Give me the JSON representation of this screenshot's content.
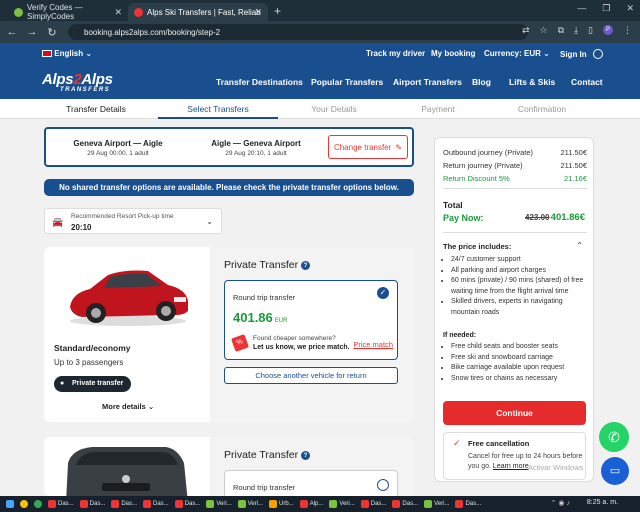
{
  "browser": {
    "tabs": [
      {
        "title": "Verify Codes — SimplyCodes",
        "active": false
      },
      {
        "title": "Alps Ski Transfers | Fast, Reliab",
        "active": true
      }
    ],
    "url": "booking.alps2alps.com/booking/step-2"
  },
  "site": {
    "language": "English",
    "top_links": {
      "track": "Track my driver",
      "booking": "My booking",
      "currency": "Currency: EUR",
      "signin": "Sign In"
    },
    "logo": {
      "text_left": "Alps",
      "text_right": "Alps",
      "mark": "2",
      "subtitle": "TRANSFERS"
    },
    "nav": [
      "Transfer Destinations",
      "Popular Transfers",
      "Airport Transfers",
      "Blog",
      "Lifts & Skis",
      "Contact"
    ]
  },
  "steps": [
    "Transfer Details",
    "Select Transfers",
    "Your Details",
    "Payment",
    "Confirmation"
  ],
  "route": {
    "outbound": {
      "title": "Geneva Airport — Aigle",
      "detail": "29 Aug 00:00, 1 adult"
    },
    "return": {
      "title": "Aigle — Geneva Airport",
      "detail": "29 Aug 20:10, 1 adult"
    },
    "change_label": "Change transfer"
  },
  "notice": "No shared transfer options are available. Please check the private transfer options below.",
  "pickup": {
    "label": "Recommended Resort Pick-up time",
    "value": "20:10"
  },
  "vehicles": [
    {
      "title": "Private Transfer",
      "class": "Standard/economy",
      "passengers": "Up to 3 passengers",
      "badge": "Private transfer",
      "more": "More details",
      "option_label": "Round trip transfer",
      "price": "401.86",
      "currency": "EUR",
      "pm_line1": "Found cheaper somewhere?",
      "pm_line2": "Let us know, we price match.",
      "pm_link": "Price match",
      "another": "Choose another vehicle for return",
      "color": "#c0141e"
    },
    {
      "title": "Private Transfer",
      "option_label": "Round trip transfer",
      "color": "#3a3f44"
    }
  ],
  "summary": {
    "outbound_label": "Outbound journey (Private)",
    "outbound_value": "211.50€",
    "return_label": "Return journey (Private)",
    "return_value": "211.50€",
    "discount_label": "Return Discount 5%",
    "discount_value": "21.16€",
    "total_label": "Total",
    "paynow_label": "Pay Now:",
    "old_price": "423.00",
    "new_price": "401.86€",
    "includes_title": "The price includes:",
    "includes": [
      "24/7 customer support",
      "All parking and airport charges",
      "60 mins (private) / 90 mins (shared) of free waiting time from the flight arrival time",
      "Skilled drivers, experts in navigating mountain roads"
    ],
    "ifneeded_title": "If needed:",
    "ifneeded": [
      "Free child seats and booster seats",
      "Free ski and snowboard carriage",
      "Bike carriage available upon request",
      "Snow tires or chains as necessary"
    ],
    "continue": "Continue",
    "freecanc_title": "Free cancellation",
    "freecanc_text": "Cancel for free up to 24 hours before you go.",
    "learn_more": "Learn more"
  },
  "watermark": "Activar Windows",
  "taskbar": {
    "items": [
      "Das...",
      "Das...",
      "Das...",
      "Das...",
      "Das...",
      "Veri...",
      "Veri...",
      "Urb...",
      "Alp...",
      "Veri...",
      "Das...",
      "Das...",
      "Veri...",
      "Das..."
    ],
    "clock": "8:25 a. m."
  },
  "colors": {
    "brand": "#1a4f8f",
    "accent": "#e52b2b",
    "green": "#1a9a3a"
  }
}
